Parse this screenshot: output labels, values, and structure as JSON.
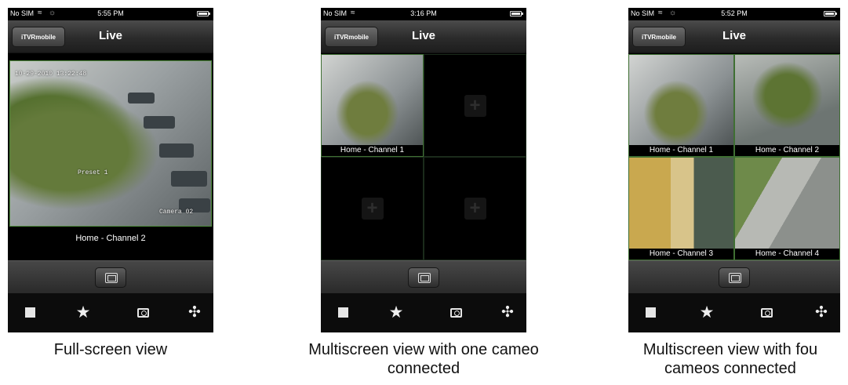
{
  "screens": [
    {
      "status": {
        "carrier": "No SIM",
        "time": "5:55 PM"
      },
      "nav": {
        "back_label": "iTVRmobile",
        "title": "Live"
      },
      "video": {
        "timestamp": "10-29-2010 13:22:48",
        "preset_label": "Preset 1",
        "camera_label": "Camera 02",
        "channel_label": "Home - Channel 2"
      },
      "caption": "Full-screen view"
    },
    {
      "status": {
        "carrier": "No SIM",
        "time": "3:16 PM"
      },
      "nav": {
        "back_label": "iTVRmobile",
        "title": "Live"
      },
      "cells": [
        {
          "label": "Home - Channel 1"
        }
      ],
      "caption_line1": "Multiscreen view with one cameo",
      "caption_line2": "connected"
    },
    {
      "status": {
        "carrier": "No SIM",
        "time": "5:52 PM"
      },
      "nav": {
        "back_label": "iTVRmobile",
        "title": "Live"
      },
      "cells": [
        {
          "label": "Home - Channel 1"
        },
        {
          "label": "Home - Channel 2"
        },
        {
          "label": "Home - Channel 3"
        },
        {
          "label": "Home - Channel 4"
        }
      ],
      "caption_line1": "Multiscreen view with fou",
      "caption_line2": "cameos connected"
    }
  ],
  "icons": {
    "multiscreen": "multiscreen-toggle-icon",
    "stop": "stop-icon",
    "favorite": "star-icon",
    "snapshot": "camera-snapshot-icon",
    "ptz": "ptz-directional-icon"
  },
  "colors": {
    "selection_border": "#3f6f33",
    "bar_background": "#2a2a2a"
  }
}
